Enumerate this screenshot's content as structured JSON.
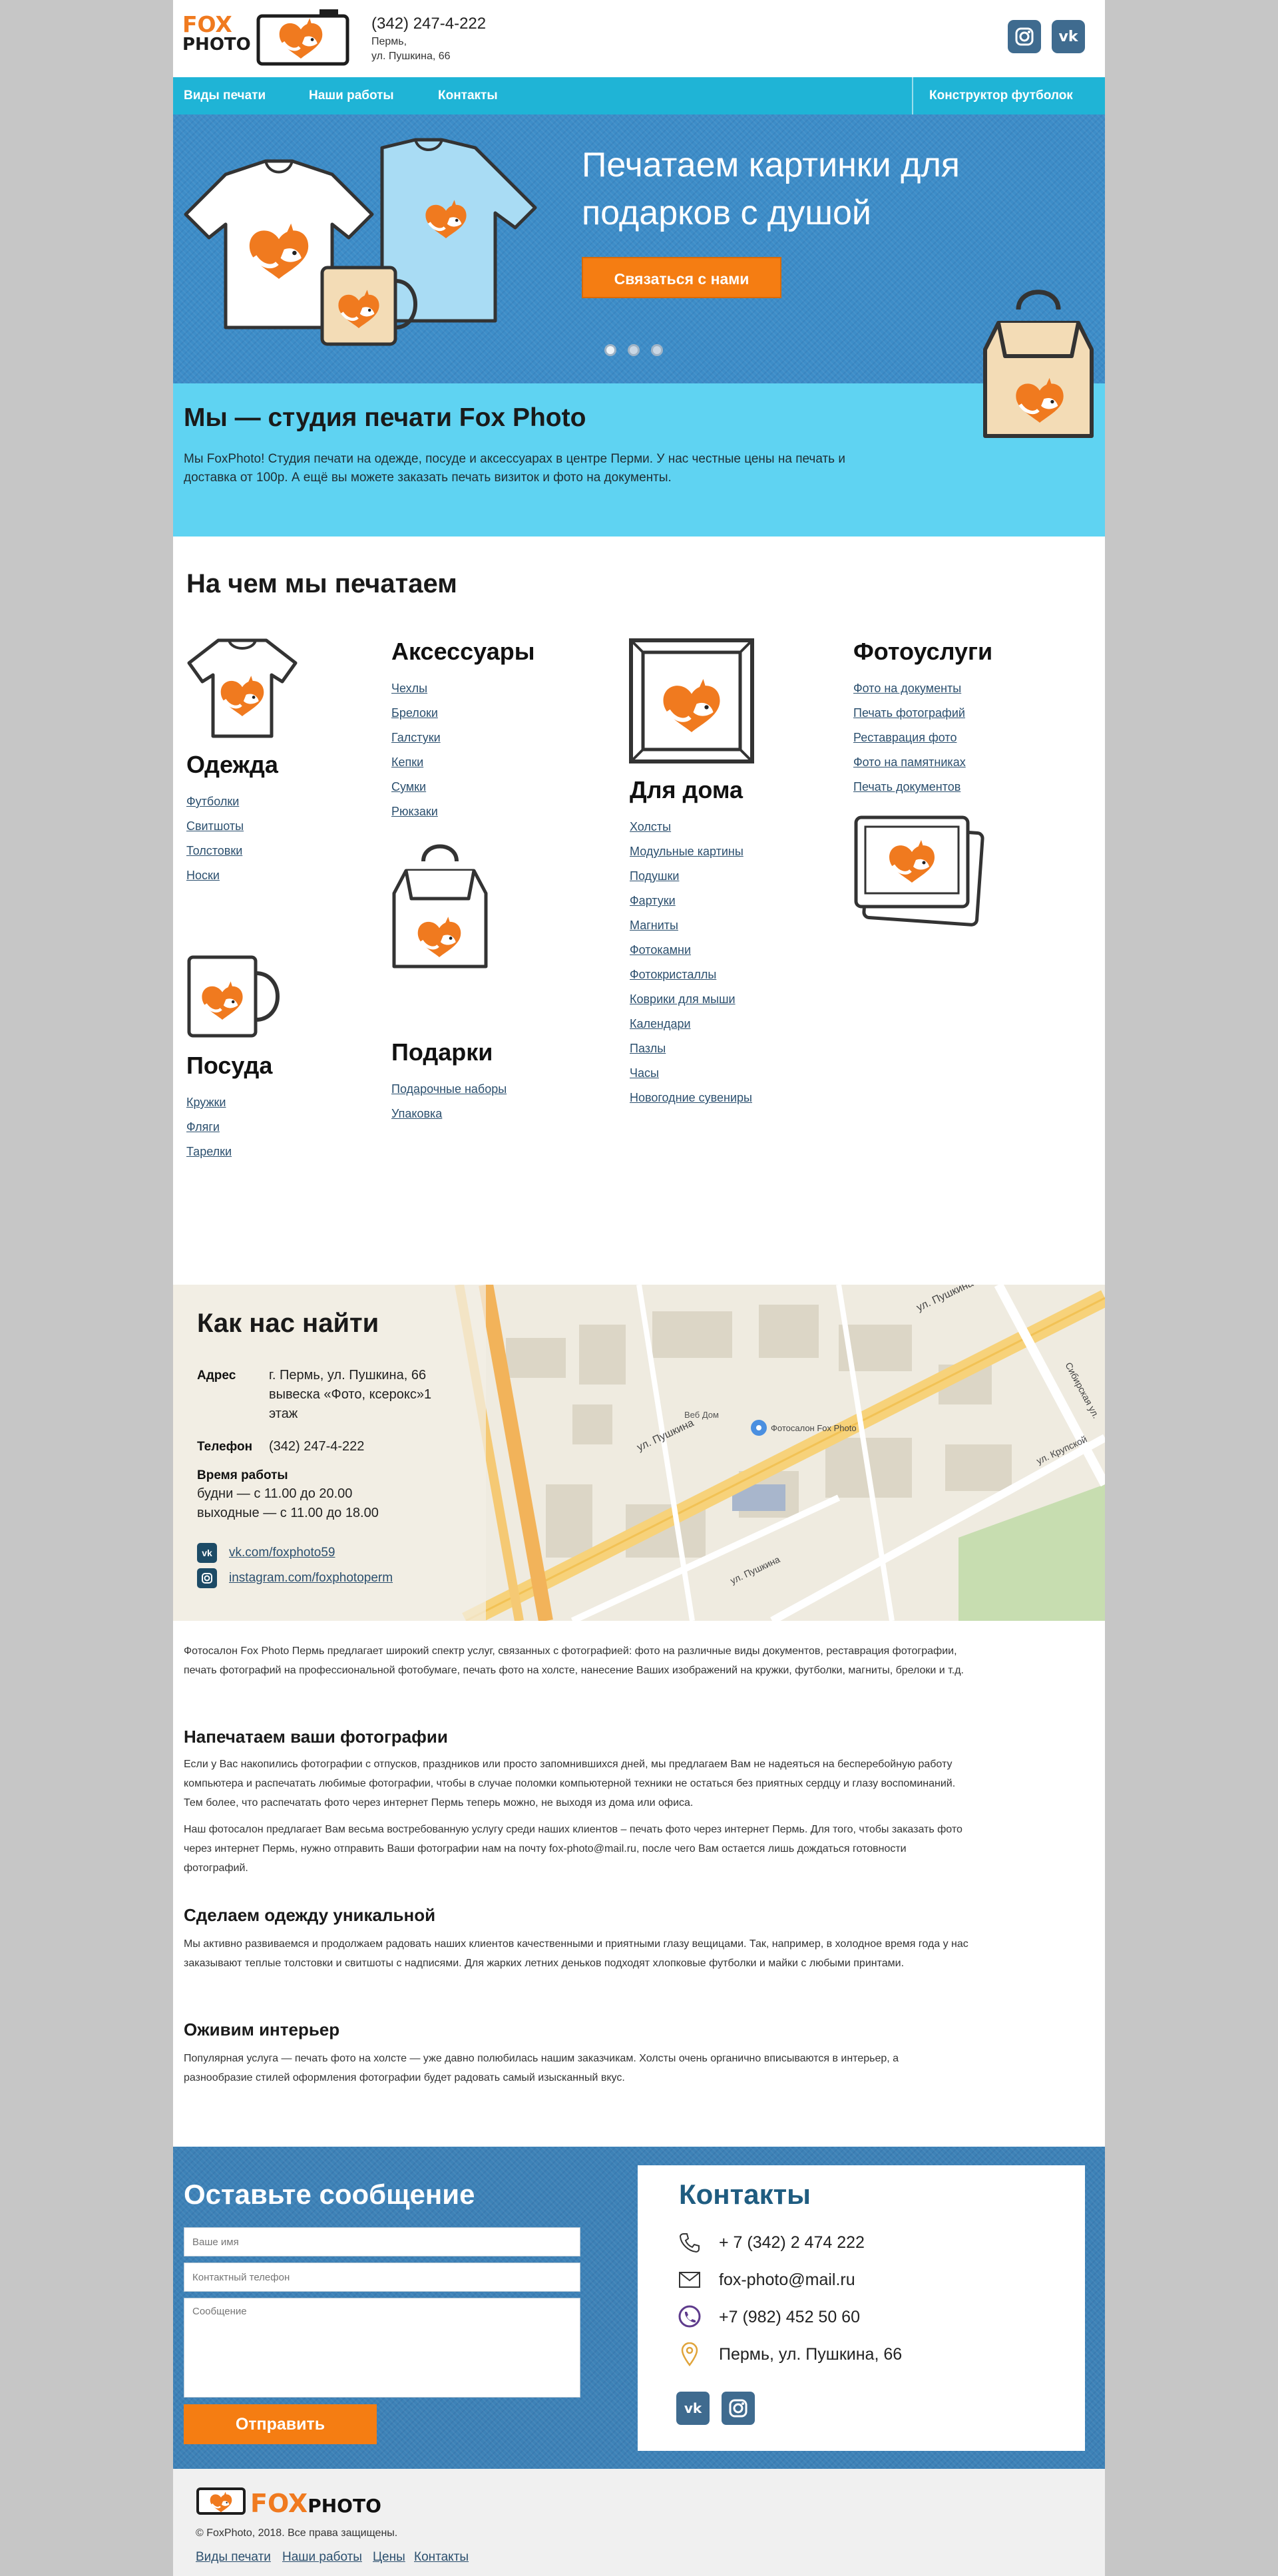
{
  "header": {
    "logo_fox": "FOX",
    "logo_photo": "PHOTO",
    "phone": "(342) 247-4-222",
    "city": "Пермь,",
    "street": "ул. Пушкина, 66"
  },
  "nav": {
    "items": [
      "Виды печати",
      "Наши работы",
      "Контакты"
    ],
    "constructor": "Конструктор футболок"
  },
  "hero": {
    "title": "Печатаем картинки для подарков с душой",
    "button": "Связаться с нами",
    "slides": 3,
    "active_slide": 1
  },
  "about": {
    "title": "Мы — студия печати Fox Photo",
    "text": "Мы FoxPhoto! Студия печати на одежде, посуде и аксессуарах в центре Перми. У нас честные цены на печать и доставка от 100р. А ещё вы можете заказать печать визиток и фото на документы."
  },
  "categories": {
    "title": "На чем мы печатаем",
    "items": [
      {
        "name": "Одежда",
        "icon": "tshirt-icon",
        "links": [
          "Футболки",
          "Свитшоты",
          "Толстовки",
          "Носки"
        ]
      },
      {
        "name": "Аксессуары",
        "icon": "",
        "links": [
          "Чехлы",
          "Брелоки",
          "Галстуки",
          "Кепки",
          "Сумки",
          "Рюкзаки"
        ]
      },
      {
        "name": "Для дома",
        "icon": "frame-icon",
        "links": [
          "Холсты",
          "Модульные картины",
          "Подушки",
          "Фартуки",
          "Магниты",
          "Фотокамни",
          "Фотокристаллы",
          "Коврики для мыши",
          "Календари",
          "Пазлы",
          "Часы",
          "Новогодние сувениры"
        ]
      },
      {
        "name": "Фотоуслуги",
        "icon": "photos-icon",
        "links": [
          "Фото на документы",
          "Печать фотографий",
          "Реставрация фото",
          "Фото на памятниках",
          "Печать документов"
        ]
      },
      {
        "name": "Посуда",
        "icon": "mug-icon",
        "links": [
          "Кружки",
          "Фляги",
          "Тарелки"
        ]
      },
      {
        "name": "Подарки",
        "icon": "bag-icon",
        "links": [
          "Подарочные наборы",
          "Упаковка"
        ]
      }
    ]
  },
  "find_us": {
    "title": "Как нас найти",
    "address_label": "Адрес",
    "address_lines": [
      "г. Пермь, ул. Пушкина, 66",
      "вывеска «Фото, ксерокс»1",
      "этаж"
    ],
    "phone_label": "Телефон",
    "phone": "(342) 247-4-222",
    "hours_label": "Время работы",
    "hours_weekdays": "будни — с 11.00 до 20.00",
    "hours_weekend": "выходные — с 11.00 до 18.00",
    "vk": "vk.com/foxphoto59",
    "instagram": "instagram.com/foxphotoperm",
    "map_labels": {
      "street_main": "ул. Пушкина",
      "street_top": "ул. Пушкина",
      "street_right": "Сибирская ул.",
      "street_krup": "ул. Крупской",
      "street_bottom": "ул. Пушкина",
      "poi": "Фотосалон Fox Photo",
      "poi_store": "Веб Дом"
    }
  },
  "seo": {
    "intro": "Фотосалон Fox Photo Пермь предлагает широкий спектр услуг, связанных с фотографией: фото на различные виды документов, реставрация фотографии, печать фотографий на профессиональной фотобумаге, печать фото на холсте, нанесение Ваших изображений на кружки, футболки, магниты, брелоки и т.д.",
    "h1": "Напечатаем ваши фотографии",
    "p1": "Если у Вас накопились фотографии с отпусков, праздников или просто запомнившихся дней, мы предлагаем Вам не надеяться на бесперебойную работу компьютера и распечатать любимые фотографии, чтобы в случае поломки компьютерной техники не остаться без приятных сердцу и глазу воспоминаний. Тем более, что распечатать фото через интернет Пермь теперь можно, не выходя из дома или офиса.",
    "p2": "Наш фотосалон предлагает Вам весьма востребованную услугу среди наших клиентов – печать фото через интернет Пермь. Для того, чтобы заказать фото через интернет Пермь, нужно отправить Ваши фотографии нам на почту fox-photo@mail.ru, после чего Вам остается лишь дождаться готовности фотографий.",
    "h2": "Сделаем одежду уникальной",
    "p3": "Мы активно развиваемся и продолжаем радовать наших клиентов качественными и приятными глазу вещицами. Так, например, в холодное время года у нас заказывают теплые толстовки и свитшоты с надписями. Для жарких летних деньков подходят хлопковые футболки и майки с любыми принтами.",
    "h3": "Оживим интерьер",
    "p4": "Популярная услуга — печать фото на холсте — уже давно полюбилась нашим заказчикам. Холсты очень органично вписываются в интерьер, а разнообразие стилей оформления фотографии будет радовать самый изысканный вкус."
  },
  "form": {
    "title": "Оставьте сообщение",
    "name_placeholder": "Ваше имя",
    "phone_placeholder": "Контактный телефон",
    "message_placeholder": "Сообщение",
    "submit": "Отправить"
  },
  "contacts": {
    "title": "Контакты",
    "phone": "+ 7 (342) 2 474 222",
    "email": "fox-photo@mail.ru",
    "viber": "+7 (982) 452 50 60",
    "address": "Пермь, ул. Пушкина, 66"
  },
  "footer": {
    "logo_fox": "FOX",
    "logo_photo": "PHOTO",
    "copyright": "© FoxPhoto, 2018. Все права защищены.",
    "links": [
      "Виды печати",
      "Наши работы",
      "Цены",
      "Контакты"
    ]
  },
  "colors": {
    "accent_orange": "#f57d12",
    "nav_blue": "#1fb4d6",
    "about_bg": "#5fd3f2",
    "link": "#2b4f6e",
    "contacts_title": "#1f5c80"
  }
}
